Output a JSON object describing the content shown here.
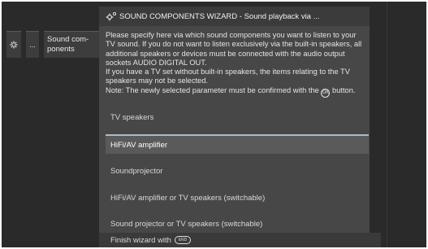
{
  "breadcrumb": {
    "more_label": "...",
    "current_label": "Sound com-ponents"
  },
  "dialog": {
    "title": "SOUND COMPONENTS WIZARD - Sound playback via ...",
    "description": [
      "Please specify here via which sound components you want to listen to your TV sound. If you do not want to listen exclusively via the built-in speakers, all additional speakers or devices must be connected with the audio output sockets AUDIO DIGITAL OUT.",
      "If you have a TV set without built-in speakers, the items relating to the TV speakers may not be selected.",
      "Note: The newly selected parameter must be confirmed with the",
      "button."
    ],
    "ok_glyph": "OK",
    "options": [
      "TV speakers",
      "HiFi/AV amplifier",
      "Soundprojector",
      "HiFi/AV amplifier or TV speakers (switchable)",
      "Sound projector or TV speakers (switchable)"
    ],
    "selected_option": "HiFi/AV amplifier",
    "footer_text": "Finish wizard with",
    "footer_key": "END"
  },
  "icons": {
    "gear": "gear-icon",
    "ok": "ok-button-icon",
    "end": "end-button-icon"
  }
}
